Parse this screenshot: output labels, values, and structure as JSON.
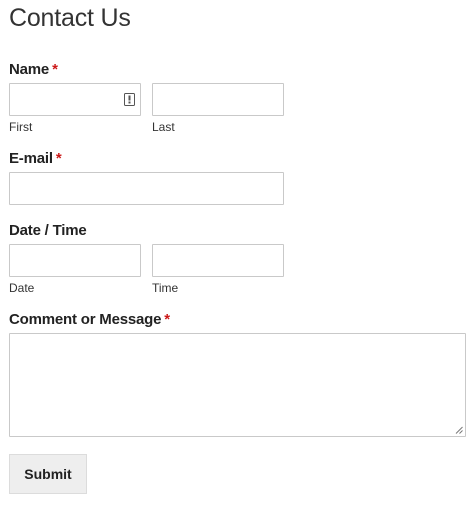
{
  "form": {
    "title": "Contact Us",
    "required_marker": "*",
    "name": {
      "label": "Name",
      "first_value": "",
      "last_value": "",
      "first_sublabel": "First",
      "last_sublabel": "Last"
    },
    "email": {
      "label": "E-mail",
      "value": ""
    },
    "datetime": {
      "label": "Date / Time",
      "date_value": "",
      "time_value": "",
      "date_sublabel": "Date",
      "time_sublabel": "Time"
    },
    "message": {
      "label": "Comment or Message",
      "value": ""
    },
    "submit_label": "Submit"
  },
  "colors": {
    "required": "#cc1818",
    "border": "#c9c9c9",
    "button_bg": "#eeeeee"
  },
  "icons": {
    "autofill": "contact-card-icon",
    "resize": "resize-grip-icon"
  }
}
